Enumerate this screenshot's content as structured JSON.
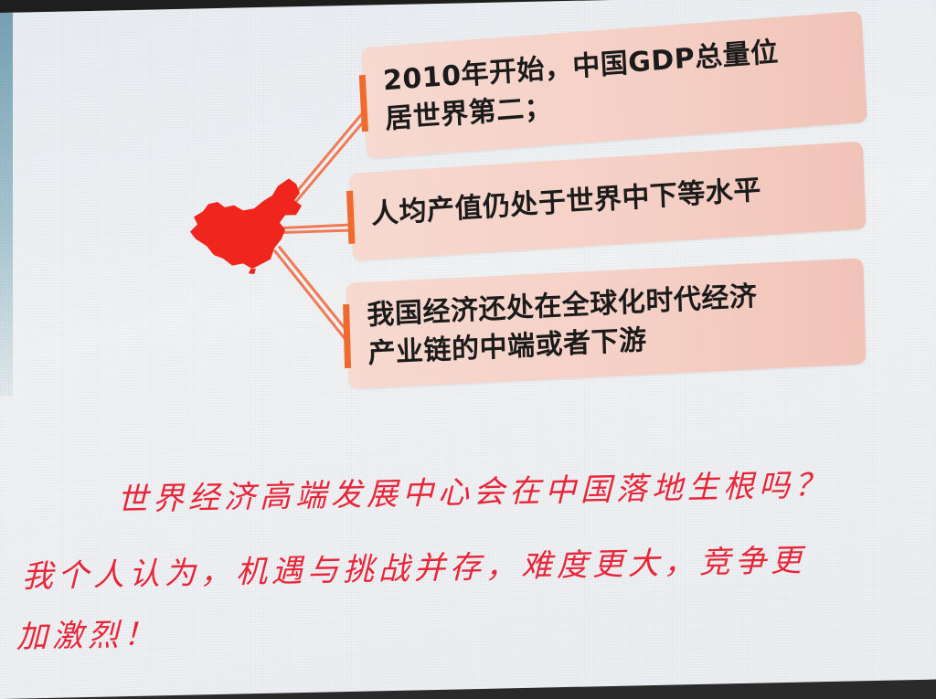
{
  "slide": {
    "boxes": [
      {
        "text": "2010年开始，中国GDP总量位\n居世界第二；"
      },
      {
        "text": "人均产值仍处于世界中下等水平"
      },
      {
        "text": "我国经济还处在全球化时代经济\n产业链的中端或者下游"
      }
    ],
    "map_icon": "china-map-icon",
    "question_line": "世界经济高端发展中心会在中国落地生根吗？",
    "opinion_line1": "我个人认为，机遇与挑战并存，难度更大，竞争更",
    "opinion_line2": "加激烈！",
    "colors": {
      "accent_red": "#e8263a",
      "map_red": "#f0261e",
      "box_fill": "#f5cfc5",
      "bar_orange": "#ef6a2c",
      "connector": "#f07a55"
    }
  }
}
